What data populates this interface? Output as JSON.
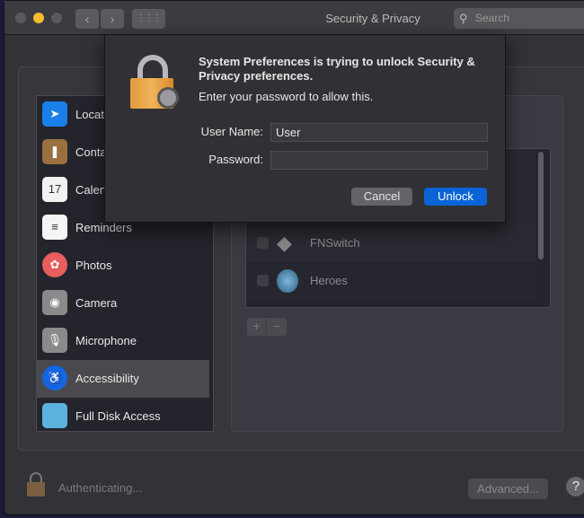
{
  "window": {
    "title": "Security & Privacy",
    "search_placeholder": "Search",
    "back": "‹",
    "forward": "›",
    "grid_icon": "grid-icon"
  },
  "sidebar": {
    "items": [
      {
        "label": "Location Services",
        "icon": "location-icon",
        "color": "#1a7fe8"
      },
      {
        "label": "Contacts",
        "icon": "contacts-icon",
        "color": "#9a7040"
      },
      {
        "label": "Calendars",
        "icon": "calendar-icon",
        "color": "#f2f2f2"
      },
      {
        "label": "Reminders",
        "icon": "reminders-icon",
        "color": "#f5f5f5"
      },
      {
        "label": "Photos",
        "icon": "photos-icon",
        "color": "#e85d5d"
      },
      {
        "label": "Camera",
        "icon": "camera-icon",
        "color": "#8a8a8a"
      },
      {
        "label": "Microphone",
        "icon": "microphone-icon",
        "color": "#8a8a8a"
      },
      {
        "label": "Accessibility",
        "icon": "accessibility-icon",
        "color": "#1466e0",
        "selected": true
      },
      {
        "label": "Full Disk Access",
        "icon": "folder-icon",
        "color": "#5bb3dd"
      }
    ]
  },
  "apps": [
    {
      "label": "FNSwitch",
      "checked": false
    },
    {
      "label": "Heroes",
      "checked": false
    }
  ],
  "list_buttons": {
    "add": "+",
    "remove": "−"
  },
  "dialog": {
    "message": "System Preferences is trying to unlock Security & Privacy preferences.",
    "prompt": "Enter your password to allow this.",
    "username_label": "User Name:",
    "username_value": "User",
    "password_label": "Password:",
    "password_value": "",
    "cancel": "Cancel",
    "unlock": "Unlock"
  },
  "footer": {
    "status": "Authenticating...",
    "advanced": "Advanced...",
    "help": "?"
  },
  "colors": {
    "accent": "#0a64d6"
  }
}
